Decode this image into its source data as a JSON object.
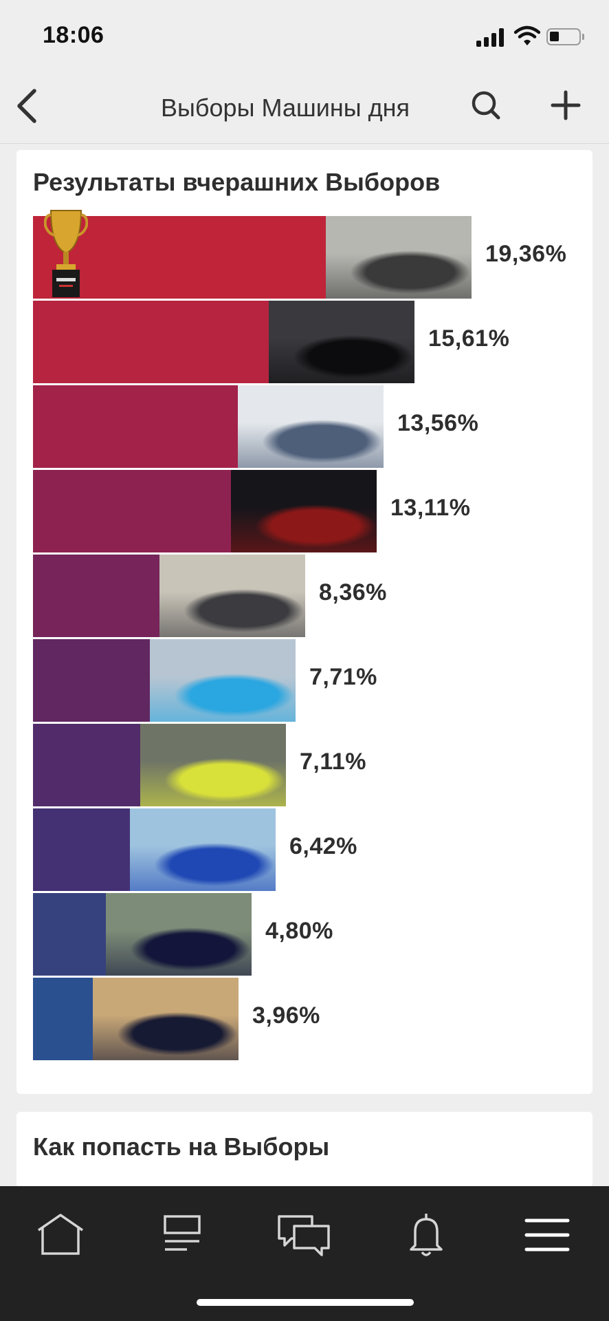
{
  "status_bar": {
    "time": "18:06",
    "signal_icon": "signal-bars-icon",
    "wifi_icon": "wifi-icon",
    "battery_icon": "battery-icon",
    "battery_level": 0.3
  },
  "nav": {
    "back_icon": "chevron-left-icon",
    "title": "Выборы Машины дня",
    "search_icon": "search-icon",
    "add_icon": "plus-icon"
  },
  "results": {
    "title": "Результаты вчерашних Выборов",
    "winner_badge_icon": "trophy-icon",
    "chart_data": {
      "type": "bar",
      "orientation": "horizontal",
      "title": "Результаты вчерашних Выборов",
      "unit": "%",
      "values": [
        19.36,
        15.61,
        13.56,
        13.11,
        8.36,
        7.71,
        7.11,
        6.42,
        4.8,
        3.96
      ],
      "labels": [
        "19,36%",
        "15,61%",
        "13,56%",
        "13,11%",
        "8,36%",
        "7,71%",
        "7,11%",
        "6,42%",
        "4,80%",
        "3,96%"
      ],
      "colors": [
        "#bf2439",
        "#b72440",
        "#a32249",
        "#8d2250",
        "#76245a",
        "#612761",
        "#522c6a",
        "#443174",
        "#36427e",
        "#2a5090"
      ],
      "photo_tones": [
        [
          "#b7b7b2",
          "#3a3a3a"
        ],
        [
          "#3a3a3e",
          "#0c0c0f"
        ],
        [
          "#e4e8ec",
          "#4e5f7a"
        ],
        [
          "#15151a",
          "#8c1818"
        ],
        [
          "#c9c4b8",
          "#3c3c40"
        ],
        [
          "#b7c5d2",
          "#2aa6e0"
        ],
        [
          "#6f7566",
          "#d8e03a"
        ],
        [
          "#9ec3df",
          "#1f48b4"
        ],
        [
          "#7d8c78",
          "#13163a"
        ],
        [
          "#c9a878",
          "#171a33"
        ]
      ]
    }
  },
  "how_to": {
    "title": "Как попасть на Выборы"
  },
  "tab_bar": {
    "tabs": [
      {
        "icon": "home-icon"
      },
      {
        "icon": "feed-icon"
      },
      {
        "icon": "messages-icon"
      },
      {
        "icon": "bell-icon"
      },
      {
        "icon": "menu-icon"
      }
    ]
  }
}
